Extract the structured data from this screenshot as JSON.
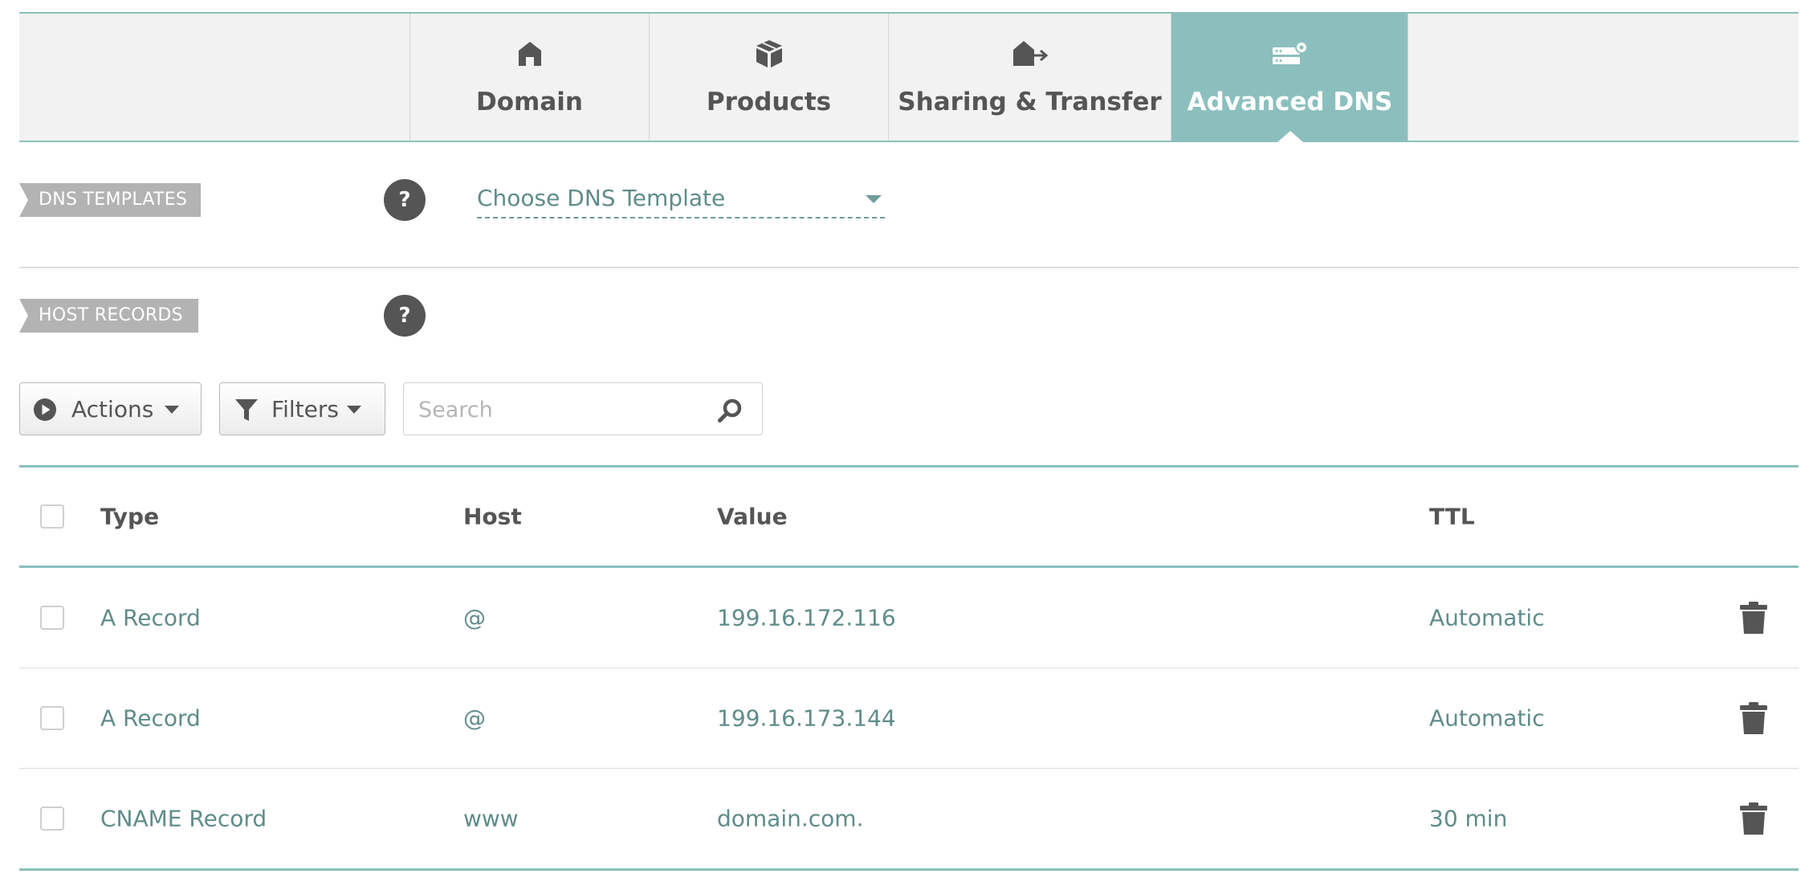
{
  "tabs": [
    {
      "label": "Domain",
      "icon": "house-icon"
    },
    {
      "label": "Products",
      "icon": "box-icon"
    },
    {
      "label": "Sharing & Transfer",
      "icon": "house-arrow-icon"
    },
    {
      "label": "Advanced DNS",
      "icon": "server-gear-icon",
      "active": true
    }
  ],
  "dns_templates": {
    "section_label": "DNS TEMPLATES",
    "help_label": "?",
    "select_value": "Choose DNS Template"
  },
  "host_records": {
    "section_label": "HOST RECORDS",
    "help_label": "?"
  },
  "toolbar": {
    "actions_label": "Actions",
    "filters_label": "Filters",
    "search_placeholder": "Search"
  },
  "table": {
    "headers": {
      "type": "Type",
      "host": "Host",
      "value": "Value",
      "ttl": "TTL"
    },
    "rows": [
      {
        "type": "A Record",
        "host": "@",
        "value": "199.16.172.116",
        "ttl": "Automatic"
      },
      {
        "type": "A Record",
        "host": "@",
        "value": "199.16.173.144",
        "ttl": "Automatic"
      },
      {
        "type": "CNAME Record",
        "host": "www",
        "value": "domain.com.",
        "ttl": "30 min"
      }
    ]
  },
  "colors": {
    "accent": "#8bbfbd",
    "link_text": "#5f8c8a",
    "ribbon": "#b3b3b3",
    "dark_icon": "#555555"
  }
}
